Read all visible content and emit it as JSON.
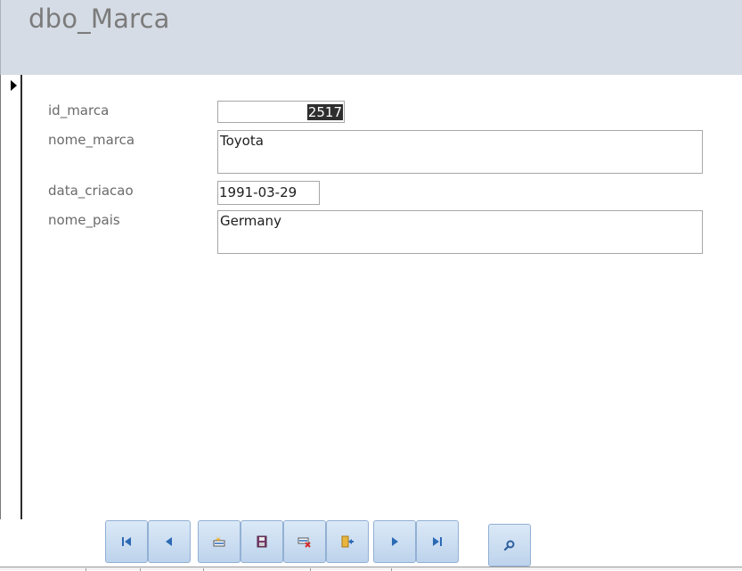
{
  "form": {
    "title": "dbo_Marca"
  },
  "fields": {
    "id_marca": {
      "label": "id_marca",
      "value": "2517"
    },
    "nome_marca": {
      "label": "nome_marca",
      "value": "Toyota"
    },
    "data_criacao": {
      "label": "data_criacao",
      "value": "1991-03-29"
    },
    "nome_pais": {
      "label": "nome_pais",
      "value": "Germany"
    }
  },
  "navigation": {
    "buttons": [
      {
        "name": "first-record-button",
        "icon": "first-record-icon"
      },
      {
        "name": "previous-record-button",
        "icon": "previous-record-icon"
      },
      {
        "name": "new-record-button",
        "icon": "new-record-icon"
      },
      {
        "name": "save-record-button",
        "icon": "save-icon"
      },
      {
        "name": "delete-record-button",
        "icon": "delete-record-icon"
      },
      {
        "name": "close-form-button",
        "icon": "exit-door-icon"
      },
      {
        "name": "next-record-button",
        "icon": "next-record-icon"
      },
      {
        "name": "last-record-button",
        "icon": "last-record-icon"
      },
      {
        "name": "search-button",
        "icon": "search-icon"
      }
    ]
  },
  "colors": {
    "header_bg": "#d6dce5",
    "button_bg": "#c9dcf0",
    "icon_blue": "#2d6ab4"
  }
}
